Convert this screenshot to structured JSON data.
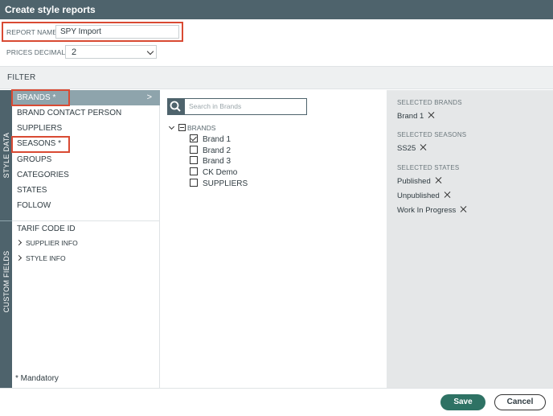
{
  "window": {
    "title": "Create style reports"
  },
  "report_name": {
    "label": "REPORT NAME:",
    "value": "SPY Import"
  },
  "prices_decimals": {
    "label": "PRICES DECIMALS:",
    "value": "2"
  },
  "filter": {
    "title": "FILTER"
  },
  "tabs": {
    "style_data": "STYLE DATA",
    "custom_fields": "CUSTOM FIELDS"
  },
  "style_data_items": [
    {
      "label": "BRANDS *"
    },
    {
      "label": "BRAND CONTACT PERSON"
    },
    {
      "label": "SUPPLIERS"
    },
    {
      "label": "SEASONS *"
    },
    {
      "label": "GROUPS"
    },
    {
      "label": "CATEGORIES"
    },
    {
      "label": "STATES"
    },
    {
      "label": "FOLLOW"
    }
  ],
  "active_arrow": ">",
  "custom_fields_items": {
    "tarif": "TARIF CODE ID",
    "supplier_info": "SUPPLIER INFO",
    "style_info": "STYLE INFO"
  },
  "mandatory_note": "* Mandatory",
  "search": {
    "placeholder": "Search in Brands"
  },
  "brands_tree": {
    "root": "BRANDS",
    "items": [
      {
        "label": "Brand 1",
        "checked": true
      },
      {
        "label": "Brand 2",
        "checked": false
      },
      {
        "label": "Brand 3",
        "checked": false
      },
      {
        "label": "CK Demo",
        "checked": false
      },
      {
        "label": "SUPPLIERS",
        "checked": false
      }
    ]
  },
  "selected": {
    "brands_heading": "SELECTED BRANDS",
    "brands": [
      "Brand 1"
    ],
    "seasons_heading": "SELECTED SEASONS",
    "seasons": [
      "SS25"
    ],
    "states_heading": "SELECTED STATES",
    "states": [
      "Published",
      "Unpublished",
      "Work In Progress"
    ]
  },
  "footer": {
    "save": "Save",
    "cancel": "Cancel"
  },
  "colors": {
    "header": "#4e636c",
    "active_item": "#8ea4ac",
    "save_button": "#2e7264",
    "highlight": "#d94a33"
  }
}
